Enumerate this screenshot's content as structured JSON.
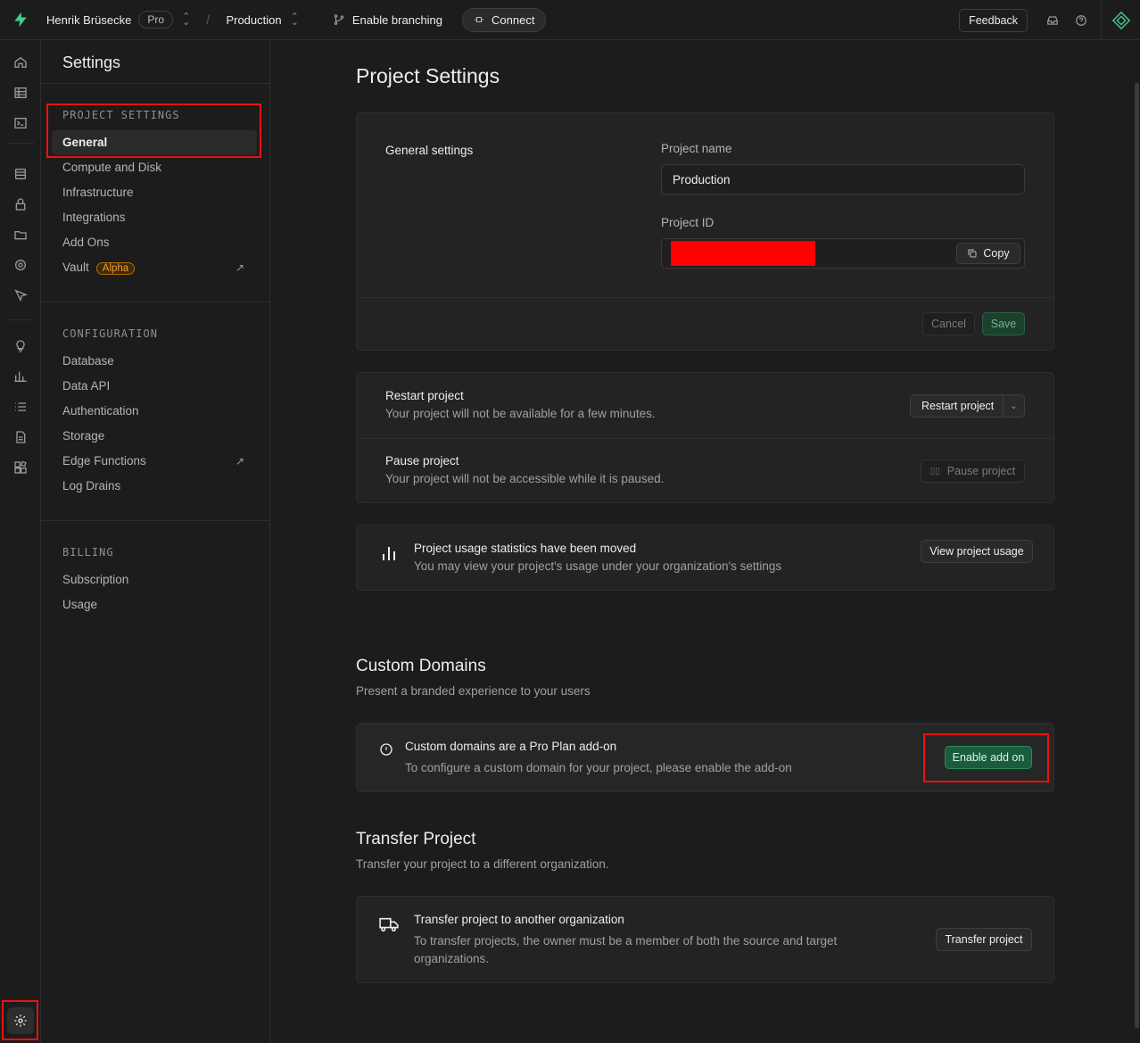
{
  "topbar": {
    "org_name": "Henrik Brüsecke",
    "plan_badge": "Pro",
    "project_name": "Production",
    "branching_label": "Enable branching",
    "connect_label": "Connect",
    "feedback_label": "Feedback"
  },
  "sidebar": {
    "title": "Settings",
    "groups": [
      {
        "label": "PROJECT SETTINGS",
        "items": [
          "General",
          "Compute and Disk",
          "Infrastructure",
          "Integrations",
          "Add Ons",
          "Vault"
        ]
      },
      {
        "label": "CONFIGURATION",
        "items": [
          "Database",
          "Data API",
          "Authentication",
          "Storage",
          "Edge Functions",
          "Log Drains"
        ]
      },
      {
        "label": "BILLING",
        "items": [
          "Subscription",
          "Usage"
        ]
      }
    ],
    "vault_badge": "Alpha"
  },
  "main": {
    "title": "Project Settings",
    "general": {
      "section_label": "General settings",
      "project_name_label": "Project name",
      "project_name_value": "Production",
      "project_id_label": "Project ID",
      "copy_label": "Copy",
      "cancel_label": "Cancel",
      "save_label": "Save"
    },
    "restart": {
      "title": "Restart project",
      "desc": "Your project will not be available for a few minutes.",
      "button": "Restart project"
    },
    "pause": {
      "title": "Pause project",
      "desc": "Your project will not be accessible while it is paused.",
      "button": "Pause project"
    },
    "usage": {
      "title": "Project usage statistics have been moved",
      "desc": "You may view your project's usage under your organization's settings",
      "button": "View project usage"
    },
    "custom_domains": {
      "title": "Custom Domains",
      "subtitle": "Present a branded experience to your users",
      "card_title": "Custom domains are a Pro Plan add-on",
      "card_desc": "To configure a custom domain for your project, please enable the add-on",
      "button": "Enable add on"
    },
    "transfer": {
      "title": "Transfer Project",
      "subtitle": "Transfer your project to a different organization.",
      "card_title": "Transfer project to another organization",
      "card_desc_1": "To transfer projects, the owner must be a member of both the source and target",
      "card_desc_2": "organizations.",
      "button": "Transfer project"
    }
  },
  "colors": {
    "accent_green": "#3ecf8e",
    "highlight_red": "#ee1111"
  }
}
